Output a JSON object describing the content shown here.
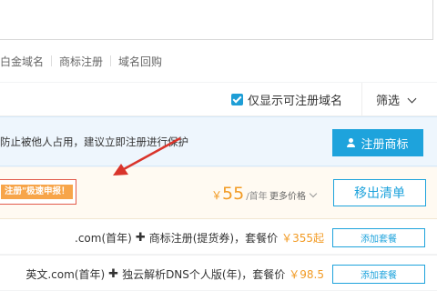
{
  "nav_links": [
    "白金域名",
    "商标注册",
    "域名回购"
  ],
  "filter": {
    "only_registrable_label": "仅显示可注册域名",
    "filter_label": "筛选"
  },
  "notice": {
    "text": "防止被他人占用，建议立即注册进行保护",
    "trademark_button": "注册商标"
  },
  "result": {
    "promo_tag": "注册\"极速申报！",
    "price_currency": "￥",
    "price_value": "55",
    "price_unit": "/首年",
    "more_price_label": "更多价格",
    "remove_button": "移出清单"
  },
  "packages": [
    {
      "name": ".com(首年)",
      "plus": "✚",
      "addon": "商标注册(提货券)，套餐价",
      "price": "￥355起",
      "button": "添加套餐"
    },
    {
      "name": "英文.com(首年)",
      "plus": "✚",
      "addon": "独云解析DNS个人版(年)，套餐价",
      "price": "￥98.5",
      "button": "添加套餐"
    }
  ],
  "colors": {
    "accent": "#1ea3dc",
    "price": "#f29b24",
    "annotation_red": "#d9342b"
  }
}
